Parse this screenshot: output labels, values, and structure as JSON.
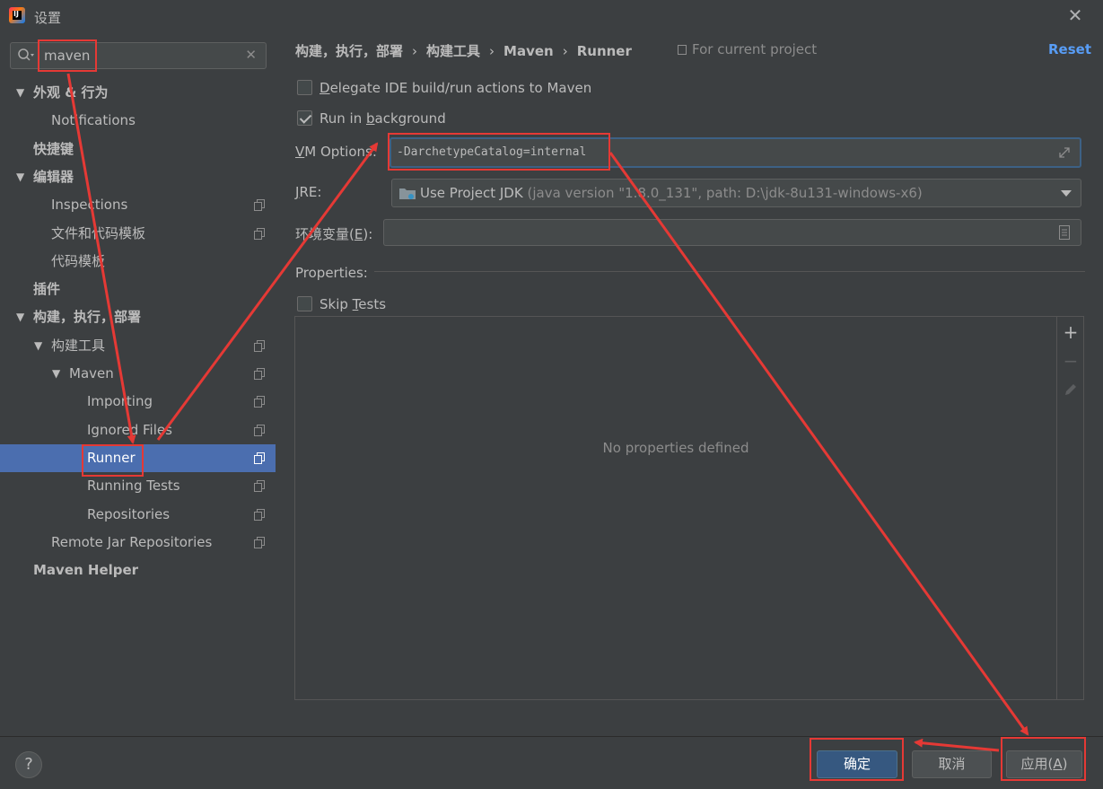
{
  "window": {
    "title": "设置"
  },
  "search": {
    "value": "maven"
  },
  "tree": {
    "items": [
      {
        "label": "外观 & 行为",
        "expanded": true,
        "bold": true
      },
      {
        "label": "Notifications"
      },
      {
        "label": "快捷键",
        "bold": true
      },
      {
        "label": "编辑器",
        "expanded": true,
        "bold": true
      },
      {
        "label": "Inspections"
      },
      {
        "label": "文件和代码模板"
      },
      {
        "label": "代码模板"
      },
      {
        "label": "插件",
        "bold": true
      },
      {
        "label": "构建，执行，部署",
        "expanded": true,
        "bold": true
      },
      {
        "label": "构建工具",
        "expanded": true
      },
      {
        "label": "Maven",
        "expanded": true
      },
      {
        "label": "Importing"
      },
      {
        "label": "Ignored Files"
      },
      {
        "label": "Runner",
        "selected": true
      },
      {
        "label": "Running Tests"
      },
      {
        "label": "Repositories"
      },
      {
        "label": "Remote Jar Repositories"
      },
      {
        "label": "Maven Helper",
        "bold": true
      }
    ]
  },
  "breadcrumb": {
    "items": [
      "构建，执行，部署",
      "构建工具",
      "Maven",
      "Runner"
    ],
    "separator": "›"
  },
  "scope": {
    "label": "For current project"
  },
  "reset": {
    "label": "Reset"
  },
  "options": {
    "delegate": {
      "label_pre": "",
      "label_u": "D",
      "label_post": "elegate IDE build/run actions to Maven",
      "checked": false
    },
    "background": {
      "label_pre": "Run in ",
      "label_u": "b",
      "label_post": "ackground",
      "checked": true
    },
    "skip_tests": {
      "label_pre": "Skip ",
      "label_u": "T",
      "label_post": "ests",
      "checked": false
    }
  },
  "vm_options": {
    "label_u": "V",
    "label_post": "M Options:",
    "value": "-DarchetypeCatalog=internal"
  },
  "jre": {
    "label_u": "J",
    "label_post": "RE:",
    "value": "Use Project JDK",
    "hint": "(java version \"1.8.0_131\", path: D:\\jdk-8u131-windows-x6)"
  },
  "env": {
    "label_pre": "环境变量(",
    "label_u": "E",
    "label_post": "):",
    "value": ""
  },
  "properties": {
    "label": "Properties:",
    "empty_text": "No properties defined",
    "toolbar": {
      "add": "+",
      "remove": "−"
    }
  },
  "footer": {
    "help": "?",
    "ok": "确定",
    "cancel": "取消",
    "apply_pre": "应用(",
    "apply_u": "A",
    "apply_post": ")"
  },
  "colors": {
    "background": "#3c3f41",
    "selection": "#4b6eaf",
    "accent_link": "#589df6",
    "annotation": "#e53935",
    "default_button": "#365880"
  }
}
